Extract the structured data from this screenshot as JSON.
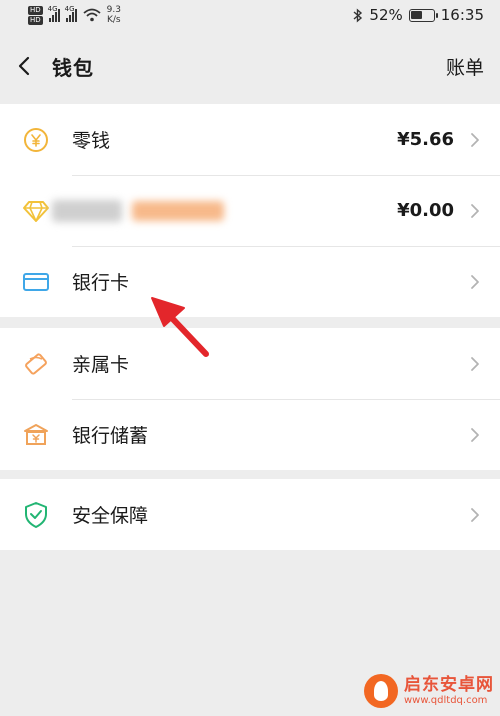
{
  "status_bar": {
    "hd1": "HD",
    "hd2": "HD",
    "sig1": "4G",
    "sig2": "4G",
    "speed_value": "9.3",
    "speed_unit": "K/s",
    "battery": "52%",
    "battery_level": 0.52,
    "time": "16:35"
  },
  "header": {
    "title": "钱包",
    "bill_label": "账单"
  },
  "group1": {
    "items": [
      {
        "label": "零钱",
        "value": "¥5.66",
        "icon": "yuan-coin-icon"
      },
      {
        "label": "",
        "value": "¥0.00",
        "icon": "diamond-icon",
        "label_redacted": true
      },
      {
        "label": "银行卡",
        "value": "",
        "icon": "bank-card-icon"
      }
    ]
  },
  "group2": {
    "items": [
      {
        "label": "亲属卡",
        "icon": "family-card-icon"
      },
      {
        "label": "银行储蓄",
        "icon": "bank-savings-icon"
      }
    ]
  },
  "group3": {
    "items": [
      {
        "label": "安全保障",
        "icon": "shield-icon"
      }
    ]
  },
  "watermark": {
    "name": "启东安卓网",
    "url": "www.qdltdq.com"
  },
  "colors": {
    "background": "#ededed",
    "coin": "#f2b53a",
    "card": "#3fa7e8",
    "family": "#f5a25d",
    "savings": "#f0a35a",
    "shield": "#22b573",
    "arrow": "#e3262b"
  }
}
